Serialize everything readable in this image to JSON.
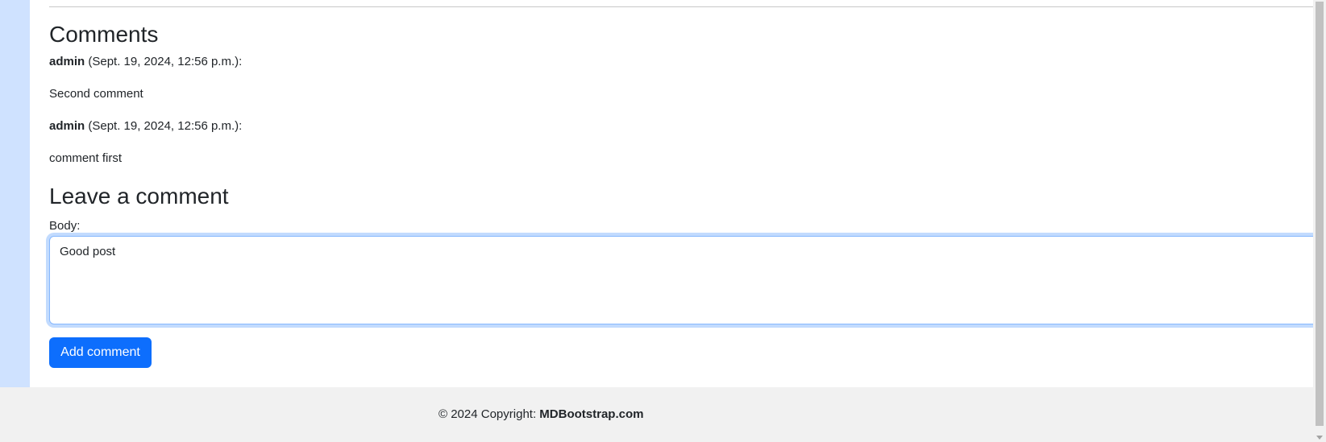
{
  "comments_section": {
    "title": "Comments",
    "items": [
      {
        "author": "admin",
        "date": " (Sept. 19, 2024, 12:56 p.m.):",
        "body": "Second comment"
      },
      {
        "author": "admin",
        "date": " (Sept. 19, 2024, 12:56 p.m.):",
        "body": "comment first"
      }
    ]
  },
  "comment_form": {
    "title": "Leave a comment",
    "body_label": "Body:",
    "body_value": "Good post",
    "submit_label": "Add comment"
  },
  "footer": {
    "copyright_prefix": "© 2024 Copyright: ",
    "brand": "MDBootstrap.com"
  },
  "colors": {
    "accent": "#0d6efd",
    "side_strip": "#cfe2ff",
    "footer_bg": "#f1f1f1"
  }
}
